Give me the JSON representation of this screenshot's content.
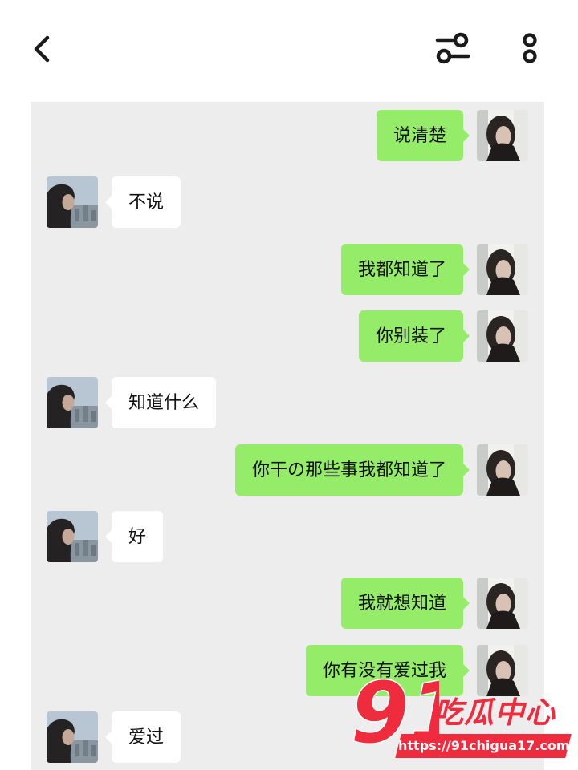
{
  "header": {
    "back_icon": "chevron-left-icon",
    "filter_icon": "sliders-icon",
    "more_icon": "vertical-dots-icon"
  },
  "messages": [
    {
      "side": "sent",
      "text": "说清楚"
    },
    {
      "side": "received",
      "text": "不说"
    },
    {
      "side": "sent",
      "text": "我都知道了"
    },
    {
      "side": "sent",
      "text": "你别装了"
    },
    {
      "side": "received",
      "text": "知道什么"
    },
    {
      "side": "sent",
      "text": "你干の那些事我都知道了"
    },
    {
      "side": "received",
      "text": "好"
    },
    {
      "side": "sent",
      "text": "我就想知道"
    },
    {
      "side": "sent",
      "text": "你有没有爱过我"
    },
    {
      "side": "received",
      "text": "爱过"
    }
  ],
  "watermark": {
    "number": "91",
    "brand": "吃瓜中心",
    "url": "https://91chigua17.com"
  },
  "colors": {
    "sent_bubble": "#95ec69",
    "received_bubble": "#ffffff",
    "chat_background": "#ededed",
    "watermark_red": "#ef2b3e"
  }
}
